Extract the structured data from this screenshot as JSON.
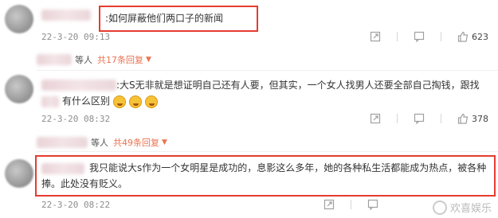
{
  "comments": [
    {
      "text": ":如何屏蔽他们两口子的新闻",
      "time": "22-3-20 09:13",
      "likes": "623"
    },
    {
      "prefix": "等人",
      "more": "共17条回复",
      "text_line1": ":大S无非就是想证明自己还有人要，但其实，一个女人找男人还要全部自己掏钱，跟找",
      "text_line2": "有什么区别",
      "time": "22-3-20 08:32",
      "likes": "378"
    },
    {
      "prefix": "等人",
      "more": "共49条回复",
      "text_line1": "我只能说大s作为一个女明星是成功的，息影这么多年，她的各种私生活都能成为热点，被各种",
      "text_line2": "捧。此处没有贬义。",
      "time": "22-3-20 08:22"
    }
  ],
  "watermark": "欢喜娱乐",
  "icons": {
    "share": "share-icon",
    "comment": "comment-icon",
    "like": "thumbs-up-icon",
    "arrow": "chevron-down-icon"
  },
  "colors": {
    "highlight": "#e53c2f",
    "reply_link": "#eb7350"
  }
}
